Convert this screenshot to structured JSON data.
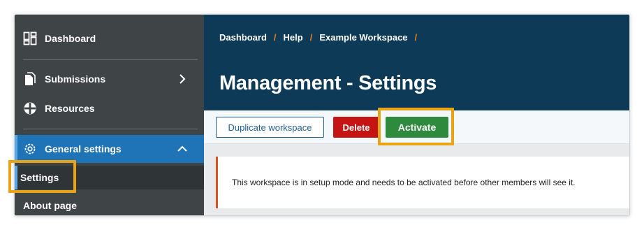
{
  "sidebar": {
    "items": [
      {
        "label": "Dashboard",
        "icon": "dashboard-icon"
      },
      {
        "label": "Submissions",
        "icon": "document-icon",
        "chevron": "chevron-right-icon"
      },
      {
        "label": "Resources",
        "icon": "globe-icon"
      },
      {
        "label": "General settings",
        "icon": "gear-icon",
        "chevron": "chevron-up-icon"
      }
    ],
    "subitems": [
      {
        "label": "Settings"
      },
      {
        "label": "About page"
      }
    ]
  },
  "breadcrumb": [
    "Dashboard",
    "Help",
    "Example Workspace"
  ],
  "page_title": "Management - Settings",
  "toolbar": {
    "duplicate_label": "Duplicate workspace",
    "delete_label": "Delete",
    "activate_label": "Activate"
  },
  "notice": {
    "text": "This workspace is in setup mode and needs to be activated before other members will see it."
  },
  "colors": {
    "sidebar_bg": "#3f4447",
    "active_nav": "#1f73b7",
    "header_bg": "#0d3a56",
    "breadcrumb_separator": "#e67e22",
    "delete_button": "#c41414",
    "activate_button": "#2e8a3c",
    "notice_border": "#d9531e",
    "highlight": "#e8a317"
  }
}
